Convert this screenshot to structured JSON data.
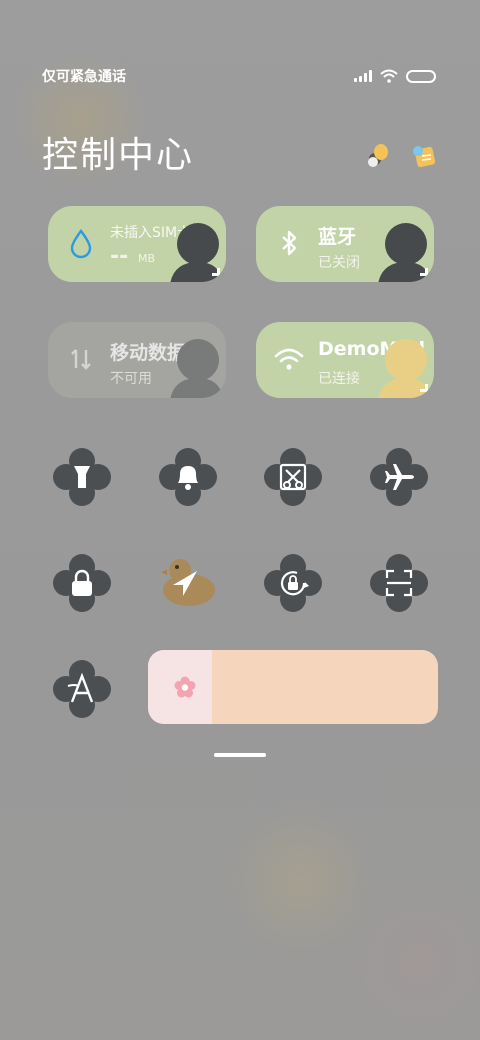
{
  "status_bar": {
    "carrier_text": "仅可紧急通话",
    "icons": [
      "signal-icon",
      "wifi-icon",
      "battery-icon"
    ]
  },
  "page": {
    "title": "控制中心",
    "top_icons": [
      "weather-icon",
      "notes-icon"
    ]
  },
  "tiles": {
    "sim": {
      "main": "未插入SIM卡",
      "value": "--",
      "unit": "MB",
      "icon": "water-drop-icon"
    },
    "bluetooth": {
      "main": "蓝牙",
      "sub": "已关闭",
      "icon": "bluetooth-icon"
    },
    "mobile_data": {
      "main": "移动数据",
      "sub": "不可用",
      "icon": "data-arrows-icon"
    },
    "wifi": {
      "main": "DemoMod",
      "sub": "已连接",
      "icon": "wifi-icon"
    }
  },
  "toggles": [
    "flashlight-icon",
    "bell-icon",
    "screenshot-icon",
    "airplane-icon",
    "lock-icon",
    "location-icon",
    "rotation-lock-icon",
    "scan-icon",
    "font-icon"
  ],
  "brightness": {
    "icon": "flower-icon",
    "level": 0.22
  },
  "colors": {
    "tile_active": "#c3d3a8",
    "clover": "#4c4f52",
    "slider_bg": "#f5d6bd",
    "slider_fill": "#f6e3e3"
  }
}
